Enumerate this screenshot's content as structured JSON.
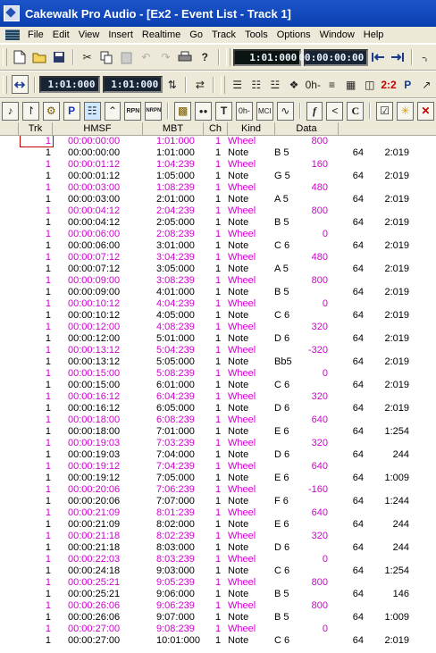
{
  "window": {
    "title": "Cakewalk Pro Audio - [Ex2 - Event List - Track 1]"
  },
  "menu": [
    "File",
    "Edit",
    "View",
    "Insert",
    "Realtime",
    "Go",
    "Track",
    "Tools",
    "Options",
    "Window",
    "Help"
  ],
  "transport": {
    "now_mbt": "1:01:000",
    "now_smpte": "00:00:00:00",
    "from": "1:01:000",
    "thru": "1:01:000"
  },
  "toolbar3_labels": {
    "p": "P",
    "rpn": "RPN",
    "nrpn": "NRPN",
    "ratio": "2:2",
    "f": "f",
    "c": "C",
    "t": "T",
    "oh": "0h-",
    "mci": "MCI"
  },
  "columns": [
    "Trk",
    "HMSF",
    "MBT",
    "Ch",
    "Kind",
    "Data"
  ],
  "events": [
    {
      "trk": "1",
      "hmsf": "00:00:00:00",
      "mbt": "1:01:000",
      "ch": "1",
      "kind": "Wheel",
      "note": "",
      "val": "800",
      "vel": "",
      "dur": ""
    },
    {
      "trk": "1",
      "hmsf": "00:00:00:00",
      "mbt": "1:01:000",
      "ch": "1",
      "kind": "Note",
      "note": "B 5",
      "val": "",
      "vel": "64",
      "dur": "2:019"
    },
    {
      "trk": "1",
      "hmsf": "00:00:01:12",
      "mbt": "1:04:239",
      "ch": "1",
      "kind": "Wheel",
      "note": "",
      "val": "160",
      "vel": "",
      "dur": ""
    },
    {
      "trk": "1",
      "hmsf": "00:00:01:12",
      "mbt": "1:05:000",
      "ch": "1",
      "kind": "Note",
      "note": "G 5",
      "val": "",
      "vel": "64",
      "dur": "2:019"
    },
    {
      "trk": "1",
      "hmsf": "00:00:03:00",
      "mbt": "1:08:239",
      "ch": "1",
      "kind": "Wheel",
      "note": "",
      "val": "480",
      "vel": "",
      "dur": ""
    },
    {
      "trk": "1",
      "hmsf": "00:00:03:00",
      "mbt": "2:01:000",
      "ch": "1",
      "kind": "Note",
      "note": "A 5",
      "val": "",
      "vel": "64",
      "dur": "2:019"
    },
    {
      "trk": "1",
      "hmsf": "00:00:04:12",
      "mbt": "2:04:239",
      "ch": "1",
      "kind": "Wheel",
      "note": "",
      "val": "800",
      "vel": "",
      "dur": ""
    },
    {
      "trk": "1",
      "hmsf": "00:00:04:12",
      "mbt": "2:05:000",
      "ch": "1",
      "kind": "Note",
      "note": "B 5",
      "val": "",
      "vel": "64",
      "dur": "2:019"
    },
    {
      "trk": "1",
      "hmsf": "00:00:06:00",
      "mbt": "2:08:239",
      "ch": "1",
      "kind": "Wheel",
      "note": "",
      "val": "0",
      "vel": "",
      "dur": ""
    },
    {
      "trk": "1",
      "hmsf": "00:00:06:00",
      "mbt": "3:01:000",
      "ch": "1",
      "kind": "Note",
      "note": "C 6",
      "val": "",
      "vel": "64",
      "dur": "2:019"
    },
    {
      "trk": "1",
      "hmsf": "00:00:07:12",
      "mbt": "3:04:239",
      "ch": "1",
      "kind": "Wheel",
      "note": "",
      "val": "480",
      "vel": "",
      "dur": ""
    },
    {
      "trk": "1",
      "hmsf": "00:00:07:12",
      "mbt": "3:05:000",
      "ch": "1",
      "kind": "Note",
      "note": "A 5",
      "val": "",
      "vel": "64",
      "dur": "2:019"
    },
    {
      "trk": "1",
      "hmsf": "00:00:09:00",
      "mbt": "3:08:239",
      "ch": "1",
      "kind": "Wheel",
      "note": "",
      "val": "800",
      "vel": "",
      "dur": ""
    },
    {
      "trk": "1",
      "hmsf": "00:00:09:00",
      "mbt": "4:01:000",
      "ch": "1",
      "kind": "Note",
      "note": "B 5",
      "val": "",
      "vel": "64",
      "dur": "2:019"
    },
    {
      "trk": "1",
      "hmsf": "00:00:10:12",
      "mbt": "4:04:239",
      "ch": "1",
      "kind": "Wheel",
      "note": "",
      "val": "0",
      "vel": "",
      "dur": ""
    },
    {
      "trk": "1",
      "hmsf": "00:00:10:12",
      "mbt": "4:05:000",
      "ch": "1",
      "kind": "Note",
      "note": "C 6",
      "val": "",
      "vel": "64",
      "dur": "2:019"
    },
    {
      "trk": "1",
      "hmsf": "00:00:12:00",
      "mbt": "4:08:239",
      "ch": "1",
      "kind": "Wheel",
      "note": "",
      "val": "320",
      "vel": "",
      "dur": ""
    },
    {
      "trk": "1",
      "hmsf": "00:00:12:00",
      "mbt": "5:01:000",
      "ch": "1",
      "kind": "Note",
      "note": "D 6",
      "val": "",
      "vel": "64",
      "dur": "2:019"
    },
    {
      "trk": "1",
      "hmsf": "00:00:13:12",
      "mbt": "5:04:239",
      "ch": "1",
      "kind": "Wheel",
      "note": "",
      "val": "-320",
      "vel": "",
      "dur": ""
    },
    {
      "trk": "1",
      "hmsf": "00:00:13:12",
      "mbt": "5:05:000",
      "ch": "1",
      "kind": "Note",
      "note": "Bb5",
      "val": "",
      "vel": "64",
      "dur": "2:019"
    },
    {
      "trk": "1",
      "hmsf": "00:00:15:00",
      "mbt": "5:08:239",
      "ch": "1",
      "kind": "Wheel",
      "note": "",
      "val": "0",
      "vel": "",
      "dur": ""
    },
    {
      "trk": "1",
      "hmsf": "00:00:15:00",
      "mbt": "6:01:000",
      "ch": "1",
      "kind": "Note",
      "note": "C 6",
      "val": "",
      "vel": "64",
      "dur": "2:019"
    },
    {
      "trk": "1",
      "hmsf": "00:00:16:12",
      "mbt": "6:04:239",
      "ch": "1",
      "kind": "Wheel",
      "note": "",
      "val": "320",
      "vel": "",
      "dur": ""
    },
    {
      "trk": "1",
      "hmsf": "00:00:16:12",
      "mbt": "6:05:000",
      "ch": "1",
      "kind": "Note",
      "note": "D 6",
      "val": "",
      "vel": "64",
      "dur": "2:019"
    },
    {
      "trk": "1",
      "hmsf": "00:00:18:00",
      "mbt": "6:08:239",
      "ch": "1",
      "kind": "Wheel",
      "note": "",
      "val": "640",
      "vel": "",
      "dur": ""
    },
    {
      "trk": "1",
      "hmsf": "00:00:18:00",
      "mbt": "7:01:000",
      "ch": "1",
      "kind": "Note",
      "note": "E 6",
      "val": "",
      "vel": "64",
      "dur": "1:254"
    },
    {
      "trk": "1",
      "hmsf": "00:00:19:03",
      "mbt": "7:03:239",
      "ch": "1",
      "kind": "Wheel",
      "note": "",
      "val": "320",
      "vel": "",
      "dur": ""
    },
    {
      "trk": "1",
      "hmsf": "00:00:19:03",
      "mbt": "7:04:000",
      "ch": "1",
      "kind": "Note",
      "note": "D 6",
      "val": "",
      "vel": "64",
      "dur": "244"
    },
    {
      "trk": "1",
      "hmsf": "00:00:19:12",
      "mbt": "7:04:239",
      "ch": "1",
      "kind": "Wheel",
      "note": "",
      "val": "640",
      "vel": "",
      "dur": ""
    },
    {
      "trk": "1",
      "hmsf": "00:00:19:12",
      "mbt": "7:05:000",
      "ch": "1",
      "kind": "Note",
      "note": "E 6",
      "val": "",
      "vel": "64",
      "dur": "1:009"
    },
    {
      "trk": "1",
      "hmsf": "00:00:20:06",
      "mbt": "7:06:239",
      "ch": "1",
      "kind": "Wheel",
      "note": "",
      "val": "-160",
      "vel": "",
      "dur": ""
    },
    {
      "trk": "1",
      "hmsf": "00:00:20:06",
      "mbt": "7:07:000",
      "ch": "1",
      "kind": "Note",
      "note": "F 6",
      "val": "",
      "vel": "64",
      "dur": "1:244"
    },
    {
      "trk": "1",
      "hmsf": "00:00:21:09",
      "mbt": "8:01:239",
      "ch": "1",
      "kind": "Wheel",
      "note": "",
      "val": "640",
      "vel": "",
      "dur": ""
    },
    {
      "trk": "1",
      "hmsf": "00:00:21:09",
      "mbt": "8:02:000",
      "ch": "1",
      "kind": "Note",
      "note": "E 6",
      "val": "",
      "vel": "64",
      "dur": "244"
    },
    {
      "trk": "1",
      "hmsf": "00:00:21:18",
      "mbt": "8:02:239",
      "ch": "1",
      "kind": "Wheel",
      "note": "",
      "val": "320",
      "vel": "",
      "dur": ""
    },
    {
      "trk": "1",
      "hmsf": "00:00:21:18",
      "mbt": "8:03:000",
      "ch": "1",
      "kind": "Note",
      "note": "D 6",
      "val": "",
      "vel": "64",
      "dur": "244"
    },
    {
      "trk": "1",
      "hmsf": "00:00:22:03",
      "mbt": "8:03:239",
      "ch": "1",
      "kind": "Wheel",
      "note": "",
      "val": "0",
      "vel": "",
      "dur": ""
    },
    {
      "trk": "1",
      "hmsf": "00:00:24:18",
      "mbt": "9:03:000",
      "ch": "1",
      "kind": "Note",
      "note": "C 6",
      "val": "",
      "vel": "64",
      "dur": "1:254"
    },
    {
      "trk": "1",
      "hmsf": "00:00:25:21",
      "mbt": "9:05:239",
      "ch": "1",
      "kind": "Wheel",
      "note": "",
      "val": "800",
      "vel": "",
      "dur": ""
    },
    {
      "trk": "1",
      "hmsf": "00:00:25:21",
      "mbt": "9:06:000",
      "ch": "1",
      "kind": "Note",
      "note": "B 5",
      "val": "",
      "vel": "64",
      "dur": "146"
    },
    {
      "trk": "1",
      "hmsf": "00:00:26:06",
      "mbt": "9:06:239",
      "ch": "1",
      "kind": "Wheel",
      "note": "",
      "val": "800",
      "vel": "",
      "dur": ""
    },
    {
      "trk": "1",
      "hmsf": "00:00:26:06",
      "mbt": "9:07:000",
      "ch": "1",
      "kind": "Note",
      "note": "B 5",
      "val": "",
      "vel": "64",
      "dur": "1:009"
    },
    {
      "trk": "1",
      "hmsf": "00:00:27:00",
      "mbt": "9:08:239",
      "ch": "1",
      "kind": "Wheel",
      "note": "",
      "val": "0",
      "vel": "",
      "dur": ""
    },
    {
      "trk": "1",
      "hmsf": "00:00:27:00",
      "mbt": "10:01:000",
      "ch": "1",
      "kind": "Note",
      "note": "C 6",
      "val": "",
      "vel": "64",
      "dur": "2:019"
    }
  ]
}
